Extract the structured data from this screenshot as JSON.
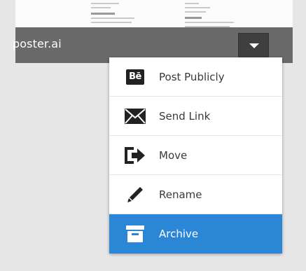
{
  "file": {
    "name": "poster.ai"
  },
  "menu": {
    "items": [
      {
        "label": "Post Publicly",
        "icon": "behance-icon"
      },
      {
        "label": "Send Link",
        "icon": "envelope-icon"
      },
      {
        "label": "Move",
        "icon": "move-arrow-icon"
      },
      {
        "label": "Rename",
        "icon": "pencil-icon"
      },
      {
        "label": "Archive",
        "icon": "archive-box-icon",
        "selected": true
      }
    ]
  },
  "colors": {
    "accent": "#2b86d6",
    "card_overlay": "#5f5f5f",
    "background": "#e6e6e6"
  }
}
